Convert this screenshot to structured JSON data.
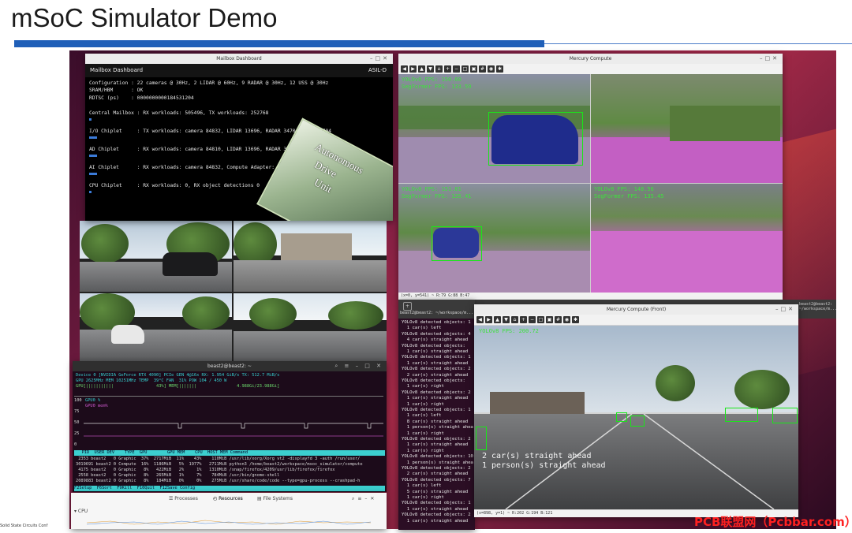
{
  "slide": {
    "title": "mSoC Simulator Demo",
    "footer_fragment": "Solid State Circuits Conf"
  },
  "watermark": "PCB联盟网（Pcbbar.com）",
  "colors": {
    "accent_blue": "#1f5fb8",
    "terminal_bg": "#000000",
    "detection_green": "#19e619"
  },
  "mailbox": {
    "window_title": "Mailbox Dashboard",
    "header": "Mailbox Dashboard",
    "badge": "ASIL-D",
    "lines": [
      "Configuration : 22 cameras @ 30Hz, 2 LIDAR @ 60Hz, 9 RADAR @ 30Hz, 12 USS @ 30Hz",
      "SRAM/HBM      : OK",
      "RDTSC (ps)    : 0000000000184531204",
      "Central Mailbox : RX workloads: 505496, TX workloads: 252768",
      "I/O Chiplet     : TX workloads: camera 84832, LIDAR 13696, RADAR 34704, USS 34704",
      "AD Chiplet      : RX workloads: camera 84810, LIDAR 13696, RADAR 34695, USS 34695",
      "AI Chiplet      : RX workloads: camera 84832, Compute Adapter: OK",
      "CPU Chiplet     : RX workloads: 0, RX object detections 0"
    ],
    "adu_letters": [
      "A",
      "D",
      "U"
    ],
    "adu_words": [
      "utonomous",
      "rive",
      "nit"
    ]
  },
  "mercury": {
    "window_title": "Mercury Compute",
    "toolbar_icons": [
      "back-icon",
      "forward-icon",
      "up-icon",
      "down-icon",
      "home-icon",
      "zoom-in-icon",
      "zoom-out-icon",
      "fit-icon",
      "save-icon",
      "grid-icon",
      "camera-icon",
      "settings-icon"
    ],
    "overlays": [
      {
        "fps": "YOLOv8 FPS: 150.60",
        "seg": "SegFormer FPS: 133.59"
      },
      {
        "fps": "",
        "seg": ""
      },
      {
        "fps": "YOLOv8 FPS: 151.81",
        "seg": "SegFormer FPS: 135.41"
      },
      {
        "fps": "YOLOv8 FPS: 148.56",
        "seg": "SegFormer FPS: 135.45"
      }
    ],
    "status": "(x=0, y=541) ~ R:79 G:88 B:47"
  },
  "nvtop": {
    "window_title": "beast2@beast2: ~",
    "device_line": "Device 0 [NVIDIA GeForce RTX 4090] PCIe GEN 4@16x RX: 1.954 GiB/s TX: 512.7 MiB/s",
    "gpu_line": "GPU 2625MHz MEM 10251MHz TEMP  39°C FAN  31% POW 104 / 450 W",
    "util_line": "GPU[|||||||||||                 43%] MEM[|||||||                4.988Gi/23.988Gi]",
    "legend": [
      "GPU0 %",
      "GPU0 mem%"
    ],
    "axis": [
      "100",
      "75",
      "50",
      "25",
      "0"
    ],
    "table_header": "   PID  USER DEV    TYPE  GPU        GPU MEM    CPU  HOST MEM Command",
    "rows": [
      " 2353 beast2   0 Graphic  37%  2717MiB  11%    43%    110MiB /usr/lib/xorg/Xorg vt2 -displayfd 3 -auth /run/user/",
      "3019691 beast2 0 Compute  16%  1186MiB   5%  1977%   2711MiB python3 /home/beast2/workspace/msoc_simulator/compute",
      " 4175 beast2   0 Graphic   8%   422MiB   2%     1%   1310MiB /snap/firefox/4209/usr/lib/firefox/firefox",
      " 2558 beast2   0 Graphic   8%   265MiB   1%     7%    784MiB /usr/bin/gnome-shell",
      "2089883 beast2 0 Graphic   8%   184MiB   0%     0%    275MiB /usr/share/code/code --type=gpu-process --crashpad-h"
    ],
    "fkeys": "F2Setup  F6Sort  F9Kill  F10Quit  F12Save Config"
  },
  "sysmon": {
    "tabs": [
      "Processes",
      "Resources",
      "File Systems"
    ],
    "section": "CPU"
  },
  "terminal": {
    "title": "beast2@beast2: ~/workspace/m...",
    "lines": [
      "YOLOv8 detected objects: 1",
      "  1 car(s) left",
      "YOLOv8 detected objects: 4",
      "  4 car(s) straight ahead",
      "YOLOv8 detected objects:",
      "  1 car(s) straight ahead",
      "YOLOv8 detected objects: 1",
      "  1 car(s) straight ahead",
      "YOLOv8 detected objects: 2",
      "  2 car(s) straight ahead",
      "YOLOv8 detected objects:",
      "  1 car(s) right",
      "YOLOv8 detected objects: 2",
      "  1 car(s) straight ahead",
      "  1 car(s) right",
      "YOLOv8 detected objects: 1",
      "  1 car(s) left",
      "  8 car(s) straight ahead",
      "  1 person(s) straight ahea",
      "  1 car(s) right",
      "YOLOv8 detected objects: 2",
      "  1 car(s) straight ahead",
      "  1 car(s) right",
      "YOLOv8 detected objects: 10",
      "  1 person(s) straight ahea",
      "YOLOv8 detected objects: 2",
      "  2 car(s) straight ahead",
      "YOLOv8 detected objects: 7",
      "  1 car(s) left",
      "  5 car(s) straight ahead",
      "  1 car(s) right",
      "YOLOv8 detected objects: 1",
      "  1 car(s) straight ahead",
      "YOLOv8 detected objects: 2",
      "  1 car(s) straight ahead"
    ]
  },
  "front": {
    "window_title": "Mercury Compute (Front)",
    "fps": "YOLOv8 FPS: 200.72",
    "summary": [
      "2 car(s) straight ahead",
      "1 person(s) straight ahead"
    ],
    "status": "(x=898, y=1) ~ R:202 G:194 B:121"
  },
  "other_terminal": {
    "title": "beast2@beast2: ~/workspace/m..."
  }
}
